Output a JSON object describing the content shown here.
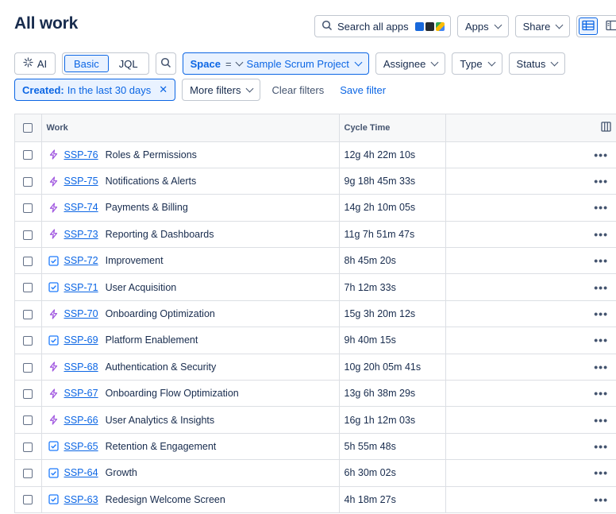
{
  "header": {
    "title": "All work"
  },
  "topbar": {
    "search_apps": "Search all apps",
    "apps": "Apps",
    "share": "Share"
  },
  "filters": {
    "ai": "AI",
    "basic": "Basic",
    "jql": "JQL",
    "space_key": "Space",
    "space_op": "=",
    "space_value": "Sample Scrum Project",
    "assignee": "Assignee",
    "type": "Type",
    "status": "Status",
    "created_key": "Created:",
    "created_value": "In the last 30 days",
    "more_filters": "More filters",
    "clear_filters": "Clear filters",
    "save_filter": "Save filter"
  },
  "table": {
    "columns": {
      "work": "Work",
      "cycle_time": "Cycle Time"
    },
    "rows": [
      {
        "key": "SSP-76",
        "summary": "Roles & Permissions",
        "cycle": "12g 4h 22m 10s",
        "type": "epic"
      },
      {
        "key": "SSP-75",
        "summary": "Notifications & Alerts",
        "cycle": "9g 18h 45m 33s",
        "type": "epic"
      },
      {
        "key": "SSP-74",
        "summary": "Payments & Billing",
        "cycle": "14g 2h 10m 05s",
        "type": "epic"
      },
      {
        "key": "SSP-73",
        "summary": "Reporting & Dashboards",
        "cycle": "11g 7h 51m 47s",
        "type": "epic"
      },
      {
        "key": "SSP-72",
        "summary": "Improvement",
        "cycle": "8h 45m 20s",
        "type": "task"
      },
      {
        "key": "SSP-71",
        "summary": "User Acquisition",
        "cycle": "7h 12m 33s",
        "type": "task"
      },
      {
        "key": "SSP-70",
        "summary": "Onboarding Optimization",
        "cycle": "15g 3h 20m 12s",
        "type": "epic"
      },
      {
        "key": "SSP-69",
        "summary": "Platform Enablement",
        "cycle": "9h 40m 15s",
        "type": "task"
      },
      {
        "key": "SSP-68",
        "summary": "Authentication & Security",
        "cycle": "10g 20h 05m 41s",
        "type": "epic"
      },
      {
        "key": "SSP-67",
        "summary": "Onboarding Flow Optimization",
        "cycle": "13g 6h 38m 29s",
        "type": "epic"
      },
      {
        "key": "SSP-66",
        "summary": "User Analytics & Insights",
        "cycle": "16g 1h 12m 03s",
        "type": "epic"
      },
      {
        "key": "SSP-65",
        "summary": "Retention & Engagement",
        "cycle": "5h 55m 48s",
        "type": "task"
      },
      {
        "key": "SSP-64",
        "summary": "Growth",
        "cycle": "6h 30m 02s",
        "type": "task"
      },
      {
        "key": "SSP-63",
        "summary": "Redesign Welcome Screen",
        "cycle": "4h 18m 27s",
        "type": "task"
      }
    ]
  },
  "colors": {
    "accent": "#0c66e4",
    "epic": "#a25ae0",
    "task": "#1d7afc"
  }
}
